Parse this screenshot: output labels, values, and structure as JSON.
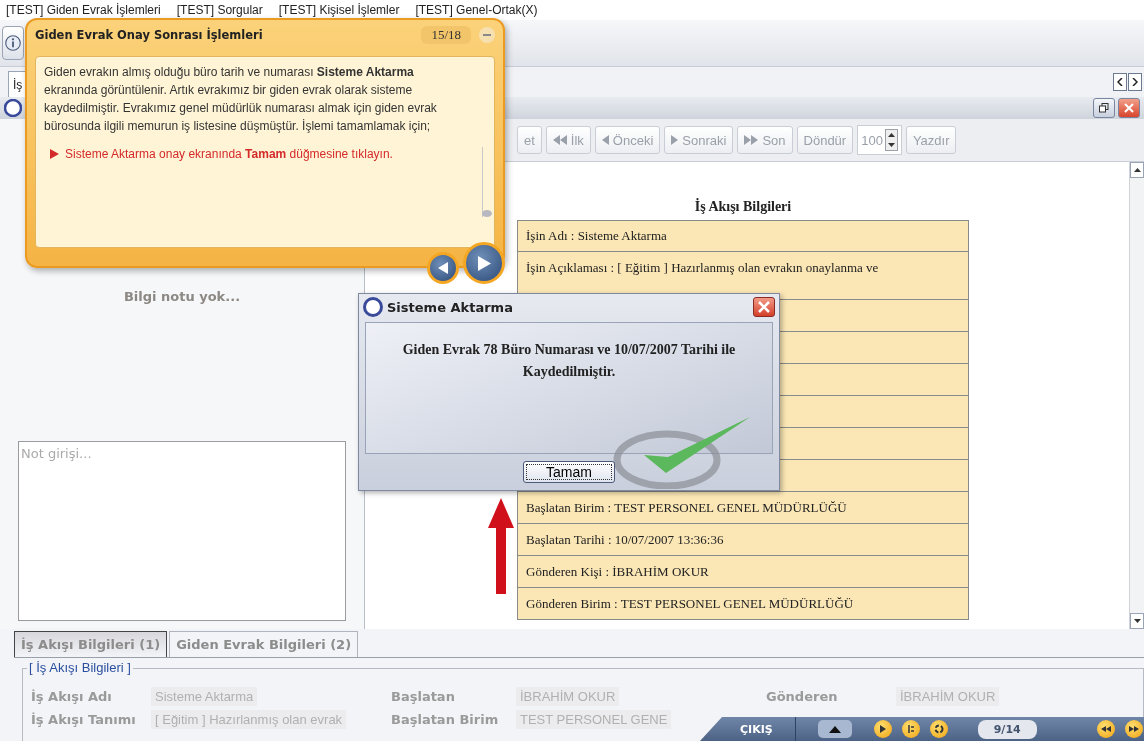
{
  "menu": [
    {
      "label": "[TEST] Giden Evrak İşlemleri"
    },
    {
      "label": "[TEST] Sorgular"
    },
    {
      "label": "[TEST] Kişisel İşlemler"
    },
    {
      "label": "[TEST] Genel-Ortak(X)"
    }
  ],
  "main_tab": {
    "label": "İş"
  },
  "left_panel": {
    "info_note": "Bilgi notu yok...",
    "note_field": {
      "placeholder": "Not girişi..."
    }
  },
  "report_toolbar": [
    {
      "kind": "plain",
      "label": "et"
    },
    {
      "kind": "first",
      "label": "İlk"
    },
    {
      "kind": "prev",
      "label": "Önceki"
    },
    {
      "kind": "next",
      "label": "Sonraki"
    },
    {
      "kind": "last",
      "label": "Son"
    },
    {
      "kind": "plain",
      "label": "Döndür"
    },
    {
      "kind": "spinner",
      "label": "100"
    },
    {
      "kind": "plain",
      "label": "Yazdır"
    }
  ],
  "report": {
    "title": "İş Akışı Bilgileri",
    "rows": [
      {
        "kind": "text",
        "text": "İşin Adı : Sisteme Aktarma"
      },
      {
        "kind": "tall",
        "text": "İşin Açıklaması : [ Eğitim ] Hazırlanmış olan evrakın onaylanma ve"
      },
      {
        "kind": "covered"
      },
      {
        "kind": "covered"
      },
      {
        "kind": "covered"
      },
      {
        "kind": "covered"
      },
      {
        "kind": "covered"
      },
      {
        "kind": "covered"
      },
      {
        "kind": "text",
        "text": "Başlatan Birim : TEST PERSONEL GENEL MÜDÜRLÜĞÜ"
      },
      {
        "kind": "text",
        "text": "Başlatan Tarihi : 10/07/2007 13:36:36"
      },
      {
        "kind": "text",
        "text": "Gönderen Kişi : İBRAHİM OKUR"
      },
      {
        "kind": "text",
        "text": "Gönderen Birim : TEST PERSONEL GENEL MÜDÜRLÜĞÜ"
      }
    ]
  },
  "bottom_tabs": [
    {
      "label": "İş Akışı Bilgileri (1)",
      "selected": true
    },
    {
      "label": "Giden Evrak Bilgileri (2)",
      "selected": false
    }
  ],
  "group": {
    "title": "[ İş Akışı Bilgileri ]",
    "rows": [
      [
        {
          "label": "İş Akışı Adı",
          "value": "Sisteme Aktarma"
        },
        {
          "label": "Başlatan",
          "value": "İBRAHİM OKUR"
        },
        {
          "label": "Gönderen",
          "value": "İBRAHİM OKUR"
        }
      ],
      [
        {
          "label": "İş Akışı Tanımı",
          "value": "[ Eğitim ] Hazırlanmış olan evrak"
        },
        {
          "label": "Başlatan Birim",
          "value": "TEST PERSONEL GENE"
        }
      ]
    ]
  },
  "dialog": {
    "title": "Sisteme Aktarma",
    "message": "Giden Evrak 78 Büro Numarası ve 10/07/2007 Tarihi ile Kaydedilmiştir.",
    "button": "Tamam"
  },
  "tutorial": {
    "title": "Giden Evrak Onay Sonrası İşlemleri",
    "counter": "15/18",
    "text": "Giden evrakın almış olduğu büro tarih ve numarası **Sisteme Aktarma** ekranında görüntülenir. Artık evrakımız bir giden evrak olarak sisteme kaydedilmiştir. Evrakımız genel müdürlük numarası almak için giden evrak bürosunda ilgili memurun iş listesine düşmüştür. İşlemi tamamlamak için;",
    "steps": [
      "Sisteme Aktarma onay ekranında **Tamam** düğmesine tıklayın."
    ]
  },
  "tutorial_bar": {
    "exit": "ÇIKIŞ",
    "page": "9/14"
  }
}
